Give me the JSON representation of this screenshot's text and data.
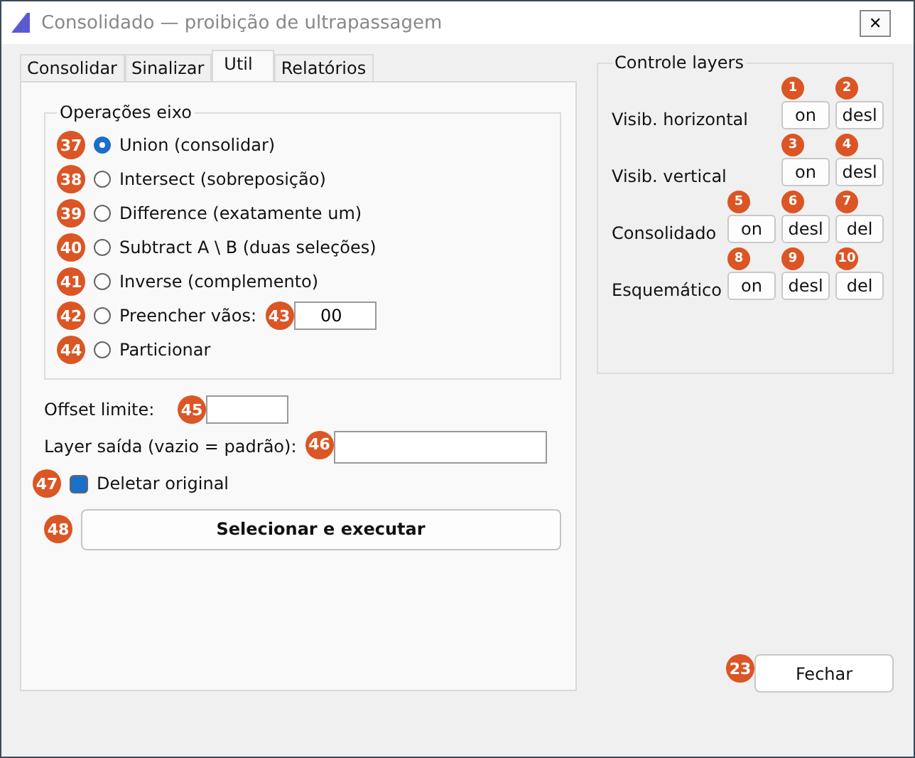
{
  "window": {
    "title": "Consolidado — proibição de ultrapassagem",
    "close": "✕"
  },
  "tabs": [
    {
      "label": "Consolidar",
      "selected": false
    },
    {
      "label": "Sinalizar",
      "selected": false
    },
    {
      "label": "Util",
      "selected": true
    },
    {
      "label": "Relatórios",
      "selected": false
    }
  ],
  "operations": {
    "title": "Operações eixo",
    "options": [
      {
        "label": "Union (consolidar)",
        "selected": true,
        "marker": "37"
      },
      {
        "label": "Intersect (sobreposição)",
        "selected": false,
        "marker": "38"
      },
      {
        "label": "Difference (exatamente um)",
        "selected": false,
        "marker": "39"
      },
      {
        "label": "Subtract A \\ B (duas seleções)",
        "selected": false,
        "marker": "40"
      },
      {
        "label": "Inverse (complemento)",
        "selected": false,
        "marker": "41"
      },
      {
        "label": "Preencher vãos:",
        "selected": false,
        "marker": "42",
        "field": {
          "value": "00",
          "marker": "43"
        }
      },
      {
        "label": "Particionar",
        "selected": false,
        "marker": "44"
      }
    ]
  },
  "offset": {
    "label": "Offset limite:",
    "marker": "45"
  },
  "output_layer": {
    "label": "Layer saída (vazio = padrão):",
    "marker": "46"
  },
  "delete_original": {
    "label": "Deletar original",
    "checked": true,
    "marker": "47"
  },
  "run_button": {
    "label": "Selecionar e executar",
    "marker": "48"
  },
  "layers": {
    "title": "Controle layers",
    "rows": [
      {
        "label": "Visib. horizontal",
        "buttons": [
          {
            "label": "on",
            "marker": "1"
          },
          {
            "label": "desl",
            "marker": "2"
          }
        ]
      },
      {
        "label": "Visib. vertical",
        "buttons": [
          {
            "label": "on",
            "marker": "3"
          },
          {
            "label": "desl",
            "marker": "4"
          }
        ]
      },
      {
        "label": "Consolidado",
        "buttons": [
          {
            "label": "on",
            "marker": "5"
          },
          {
            "label": "desl",
            "marker": "6"
          },
          {
            "label": "del",
            "marker": "7"
          }
        ]
      },
      {
        "label": "Esquemático",
        "buttons": [
          {
            "label": "on",
            "marker": "8"
          },
          {
            "label": "desl",
            "marker": "9"
          },
          {
            "label": "del",
            "marker": "10"
          }
        ]
      }
    ]
  },
  "close_button": {
    "label": "Fechar",
    "marker": "23"
  }
}
